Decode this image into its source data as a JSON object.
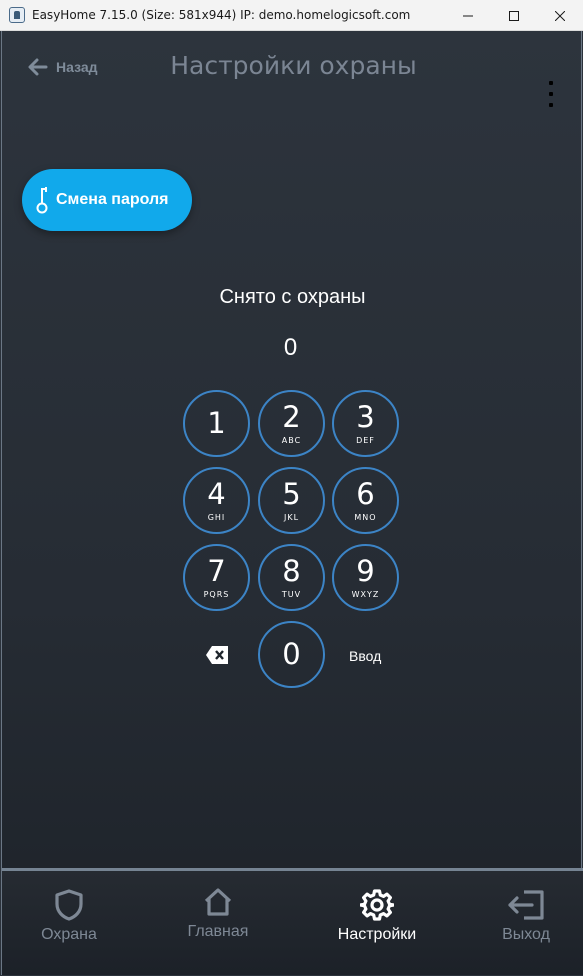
{
  "window": {
    "title": "EasyHome 7.15.0 (Size: 581x944) IP: demo.homelogicsoft.com",
    "minimize_icon": "minimize-icon",
    "maximize_icon": "maximize-icon",
    "close_icon": "close-icon"
  },
  "header": {
    "back_label": "Назад",
    "back_icon": "arrow-left-icon",
    "title": "Настройки охраны",
    "menu_icon": "kebab-menu-icon"
  },
  "change_password": {
    "label": "Смена пароля",
    "icon": "key-icon",
    "color": "#11a9eb"
  },
  "keypad": {
    "status": "Снято с охраны",
    "entry": "0",
    "ring_color": "#3c84c6",
    "keys": [
      {
        "num": "1",
        "letters": ""
      },
      {
        "num": "2",
        "letters": "ABC"
      },
      {
        "num": "3",
        "letters": "DEF"
      },
      {
        "num": "4",
        "letters": "GHI"
      },
      {
        "num": "5",
        "letters": "JKL"
      },
      {
        "num": "6",
        "letters": "MNO"
      },
      {
        "num": "7",
        "letters": "PQRS"
      },
      {
        "num": "8",
        "letters": "TUV"
      },
      {
        "num": "9",
        "letters": "WXYZ"
      },
      {
        "num": "0",
        "letters": ""
      }
    ],
    "backspace_icon": "backspace-icon",
    "enter_label": "Ввод"
  },
  "bottom_nav": {
    "items": [
      {
        "label": "Охрана",
        "icon": "shield-icon",
        "active": false
      },
      {
        "label": "Главная",
        "icon": "home-icon",
        "active": false
      },
      {
        "label": "Настройки",
        "icon": "gear-icon",
        "active": true
      },
      {
        "label": "Выход",
        "icon": "logout-icon",
        "active": false
      }
    ]
  }
}
